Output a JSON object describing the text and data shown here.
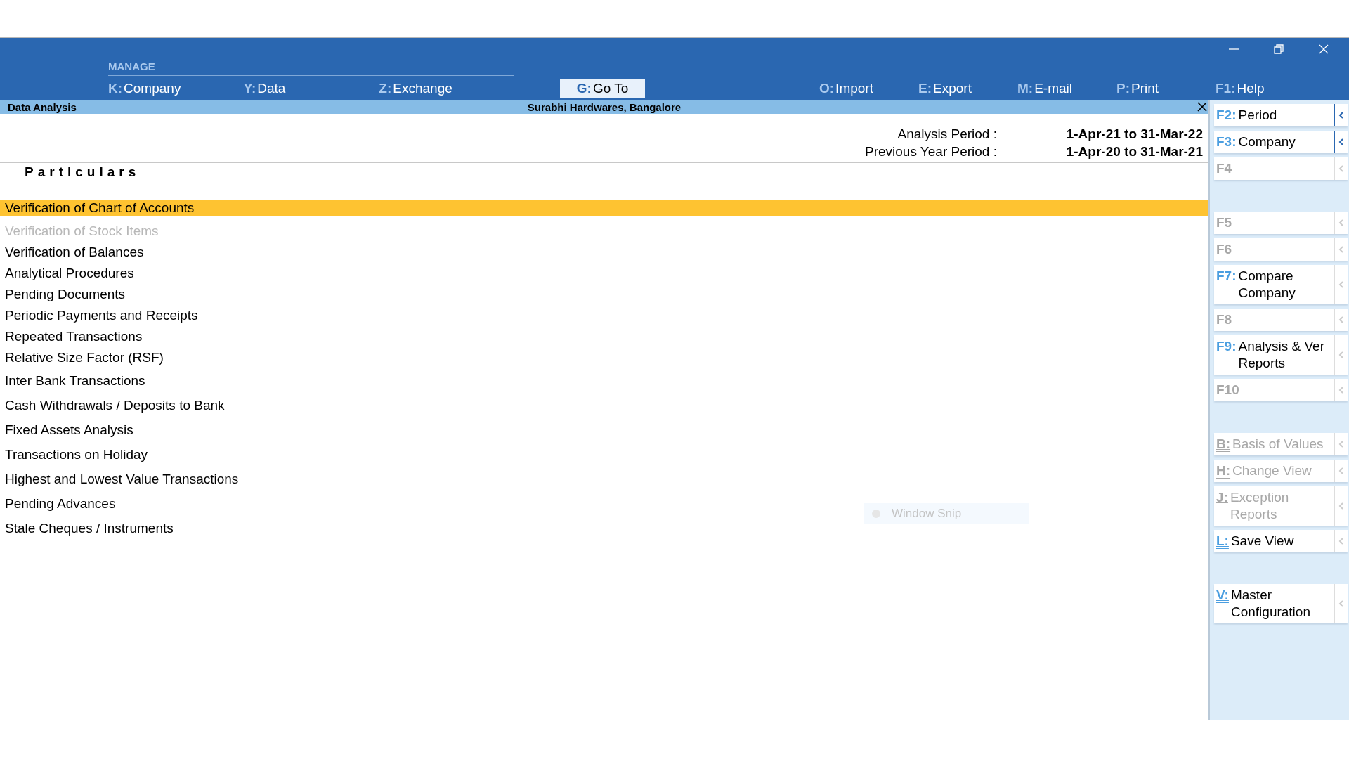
{
  "menu": {
    "group_label": "MANAGE",
    "group_items": [
      {
        "key": "K:",
        "label": "Company",
        "selected": false
      },
      {
        "key": "Y:",
        "label": "Data",
        "selected": false
      },
      {
        "key": "Z:",
        "label": "Exchange",
        "selected": false
      }
    ],
    "items": [
      {
        "key": "G:",
        "label": "Go To",
        "selected": true
      },
      {
        "key": "O:",
        "label": "Import",
        "selected": false
      },
      {
        "key": "E:",
        "label": "Export",
        "selected": false
      },
      {
        "key": "M:",
        "label": "E-mail",
        "selected": false
      },
      {
        "key": "P:",
        "label": "Print",
        "selected": false
      },
      {
        "key": "F1:",
        "label": "Help",
        "selected": false
      }
    ]
  },
  "title_bar": {
    "report": "Data Analysis",
    "company": "Surabhi Hardwares, Bangalore"
  },
  "periods": [
    {
      "label": "Analysis Period :",
      "value": "1-Apr-21 to 31-Mar-22"
    },
    {
      "label": "Previous Year Period :",
      "value": "1-Apr-20 to 31-Mar-21"
    }
  ],
  "column_header": "Particulars",
  "rows": [
    {
      "text": "Verification of Chart of Accounts",
      "kind": "compact",
      "selected": true,
      "disabled": false
    },
    {
      "text": "Verification of Stock Items",
      "kind": "compact",
      "selected": false,
      "disabled": true
    },
    {
      "text": "Verification of Balances",
      "kind": "compact",
      "selected": false,
      "disabled": false
    },
    {
      "text": "Analytical Procedures",
      "kind": "compact",
      "selected": false,
      "disabled": false
    },
    {
      "text": "Pending Documents",
      "kind": "compact",
      "selected": false,
      "disabled": false
    },
    {
      "text": "Periodic Payments and Receipts",
      "kind": "compact",
      "selected": false,
      "disabled": false
    },
    {
      "text": "Repeated Transactions",
      "kind": "compact",
      "selected": false,
      "disabled": false
    },
    {
      "text": "Relative Size Factor (RSF)",
      "kind": "compact",
      "selected": false,
      "disabled": false
    },
    {
      "text": "Inter Bank Transactions",
      "kind": "spaced",
      "selected": false,
      "disabled": false
    },
    {
      "text": "Cash Withdrawals / Deposits to Bank",
      "kind": "spaced",
      "selected": false,
      "disabled": false
    },
    {
      "text": "Fixed Assets Analysis",
      "kind": "spaced",
      "selected": false,
      "disabled": false
    },
    {
      "text": "Transactions on Holiday",
      "kind": "spaced",
      "selected": false,
      "disabled": false
    },
    {
      "text": "Highest and Lowest Value Transactions",
      "kind": "spaced",
      "selected": false,
      "disabled": false
    },
    {
      "text": "Pending Advances",
      "kind": "spaced",
      "selected": false,
      "disabled": false
    },
    {
      "text": "Stale Cheques / Instruments",
      "kind": "spaced",
      "selected": false,
      "disabled": false
    }
  ],
  "side_panel": [
    {
      "kind": "button",
      "key": "F2:",
      "label": "Period",
      "disabled": false,
      "underlined": false,
      "chevron_active": true
    },
    {
      "kind": "button",
      "key": "F3:",
      "label": "Company",
      "disabled": false,
      "underlined": false,
      "chevron_active": true
    },
    {
      "kind": "button",
      "key": "F4",
      "disabled": true,
      "underlined": false,
      "chevron_active": false
    },
    {
      "kind": "gap"
    },
    {
      "kind": "button",
      "key": "F5",
      "disabled": true,
      "underlined": false,
      "chevron_active": false
    },
    {
      "kind": "button",
      "key": "F6",
      "disabled": true,
      "underlined": false,
      "chevron_active": false
    },
    {
      "kind": "button",
      "key": "F7:",
      "label": "Compare Company",
      "disabled": false,
      "underlined": false,
      "chevron_active": false
    },
    {
      "kind": "button",
      "key": "F8",
      "disabled": true,
      "underlined": false,
      "chevron_active": false
    },
    {
      "kind": "button",
      "key": "F9:",
      "label": "Analysis & Ver Reports",
      "disabled": false,
      "underlined": false,
      "chevron_active": false
    },
    {
      "kind": "button",
      "key": "F10",
      "disabled": true,
      "underlined": false,
      "chevron_active": false
    },
    {
      "kind": "gap"
    },
    {
      "kind": "button",
      "key": "B:",
      "label": "Basis of Values",
      "disabled": true,
      "underlined": true,
      "chevron_active": false
    },
    {
      "kind": "button",
      "key": "H:",
      "label": "Change View",
      "disabled": true,
      "underlined": true,
      "chevron_active": false
    },
    {
      "kind": "button",
      "key": "J:",
      "label": "Exception Reports",
      "disabled": true,
      "underlined": true,
      "chevron_active": false
    },
    {
      "kind": "button",
      "key": "L:",
      "label": "Save View",
      "disabled": false,
      "underlined": true,
      "chevron_active": false
    },
    {
      "kind": "gap"
    },
    {
      "kind": "button",
      "key": "V:",
      "label": "Master Configuration",
      "disabled": false,
      "underlined": true,
      "chevron_active": false
    }
  ],
  "overlay": {
    "label": "Window Snip"
  }
}
